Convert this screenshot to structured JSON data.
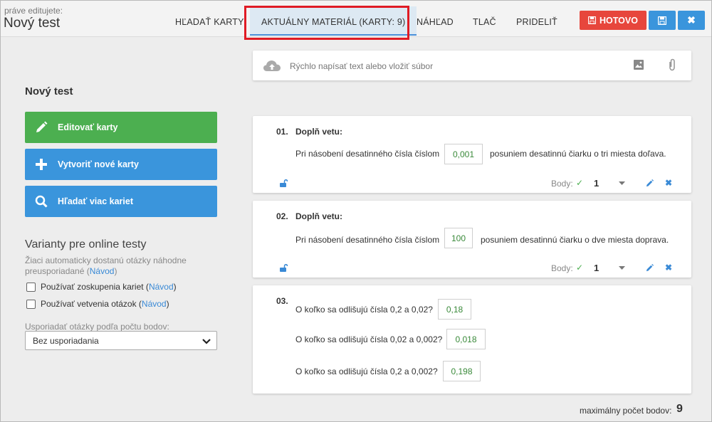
{
  "header": {
    "editing_label": "práve editujete:",
    "editing_title": "Nový test",
    "tabs": [
      {
        "label": "HĽADAŤ KARTY"
      },
      {
        "label": "AKTUÁLNY MATERIÁL (KARTY: 9)"
      },
      {
        "label": "NÁHĽAD"
      },
      {
        "label": "TLAČ"
      },
      {
        "label": "PRIDELIŤ"
      }
    ],
    "done_label": "HOTOVO",
    "highlight_color": "#e01b24",
    "done_color": "#e7463c",
    "accent_color": "#3a95dc"
  },
  "sidebar": {
    "title": "Nový test",
    "buttons": [
      {
        "label": "Editovať karty",
        "icon": "pencil-icon",
        "color": "#4caf50"
      },
      {
        "label": "Vytvoriť nové karty",
        "icon": "plus-icon",
        "color": "#3a95dc"
      },
      {
        "label": "Hľadať viac kariet",
        "icon": "search-icon",
        "color": "#3a95dc"
      }
    ],
    "variants_title": "Varianty pre online testy",
    "variants_desc": "Žiaci automaticky dostanú otázky náhodne preusporiadané",
    "help_link": "Návod",
    "checkboxes": [
      {
        "label": "Používať zoskupenia kariet",
        "link": "Návod"
      },
      {
        "label": "Používať vetvenia otázok",
        "link": "Návod"
      }
    ],
    "sort_label": "Usporiadať otázky podľa počtu bodov:",
    "sort_value": "Bez usporiadania"
  },
  "quick_input": {
    "placeholder": "Rýchlo napísať text alebo vložiť súbor"
  },
  "cards": [
    {
      "num": "01.",
      "title": "Doplň vetu:",
      "before": "Pri násobení desatinného čísla číslom",
      "answer": "0,001",
      "after": "posuniem desatinnú čiarku o tri miesta doľava.",
      "points_label": "Body:",
      "points": "1"
    },
    {
      "num": "02.",
      "title": "Doplň vetu:",
      "before": "Pri násobení desatinného čísla číslom",
      "answer": "100",
      "after": "posuniem desatinnú čiarku o dve miesta doprava.",
      "points_label": "Body:",
      "points": "1"
    },
    {
      "num": "03.",
      "questions": [
        {
          "text": "O koľko sa odlišujú čísla 0,2 a 0,02?",
          "answer": "0,18"
        },
        {
          "text": "O koľko sa odlišujú čísla 0,02 a 0,002?",
          "answer": "0,018"
        },
        {
          "text": "O koľko sa odlišujú čísla 0,2 a 0,002?",
          "answer": "0,198"
        }
      ]
    }
  ],
  "footer": {
    "max_points_label": "maximálny počet bodov:",
    "max_points": "9"
  }
}
